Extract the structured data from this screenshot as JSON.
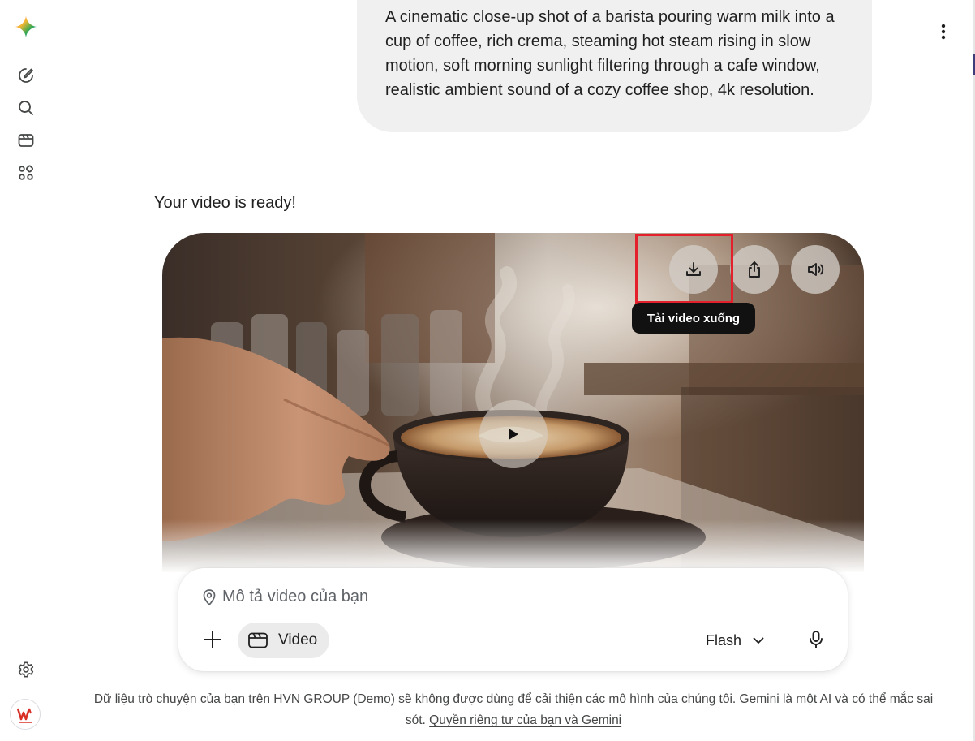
{
  "conversation": {
    "user_prompt": "A cinematic close-up shot of a barista pouring warm milk into a cup of coffee, rich crema, steaming hot steam rising in slow motion, soft morning sunlight filtering through a cafe window, realistic ambient sound of a cozy coffee shop, 4k resolution.",
    "reply_text": "Your video is ready!"
  },
  "video_player": {
    "download_tooltip": "Tải video xuống"
  },
  "composer": {
    "placeholder": "Mô tả video của bạn",
    "video_chip_label": "Video",
    "model_label": "Flash"
  },
  "footer": {
    "disclaimer_text": "Dữ liệu trò chuyện của bạn trên HVN GROUP (Demo) sẽ không được dùng để cải thiện các mô hình của chúng tôi. Gemini là một AI và có thể mắc sai sót.",
    "privacy_link": "Quyền riêng tư của bạn và Gemini"
  },
  "sidebar": {
    "avatar_logo_text": "HVN GROUP"
  },
  "colors": {
    "highlight": "#e3202c",
    "tooltip_bg": "#111111",
    "prompt_bubble": "#f0f0f0"
  },
  "icons": [
    "gemini-logo-icon",
    "new-chat-icon",
    "search-icon",
    "video-gallery-icon",
    "apps-icon",
    "settings-icon",
    "more-vert-icon",
    "download-icon",
    "share-icon",
    "volume-icon",
    "play-icon",
    "location-pin-icon",
    "plus-icon",
    "video-icon",
    "chevron-down-icon",
    "microphone-icon"
  ]
}
